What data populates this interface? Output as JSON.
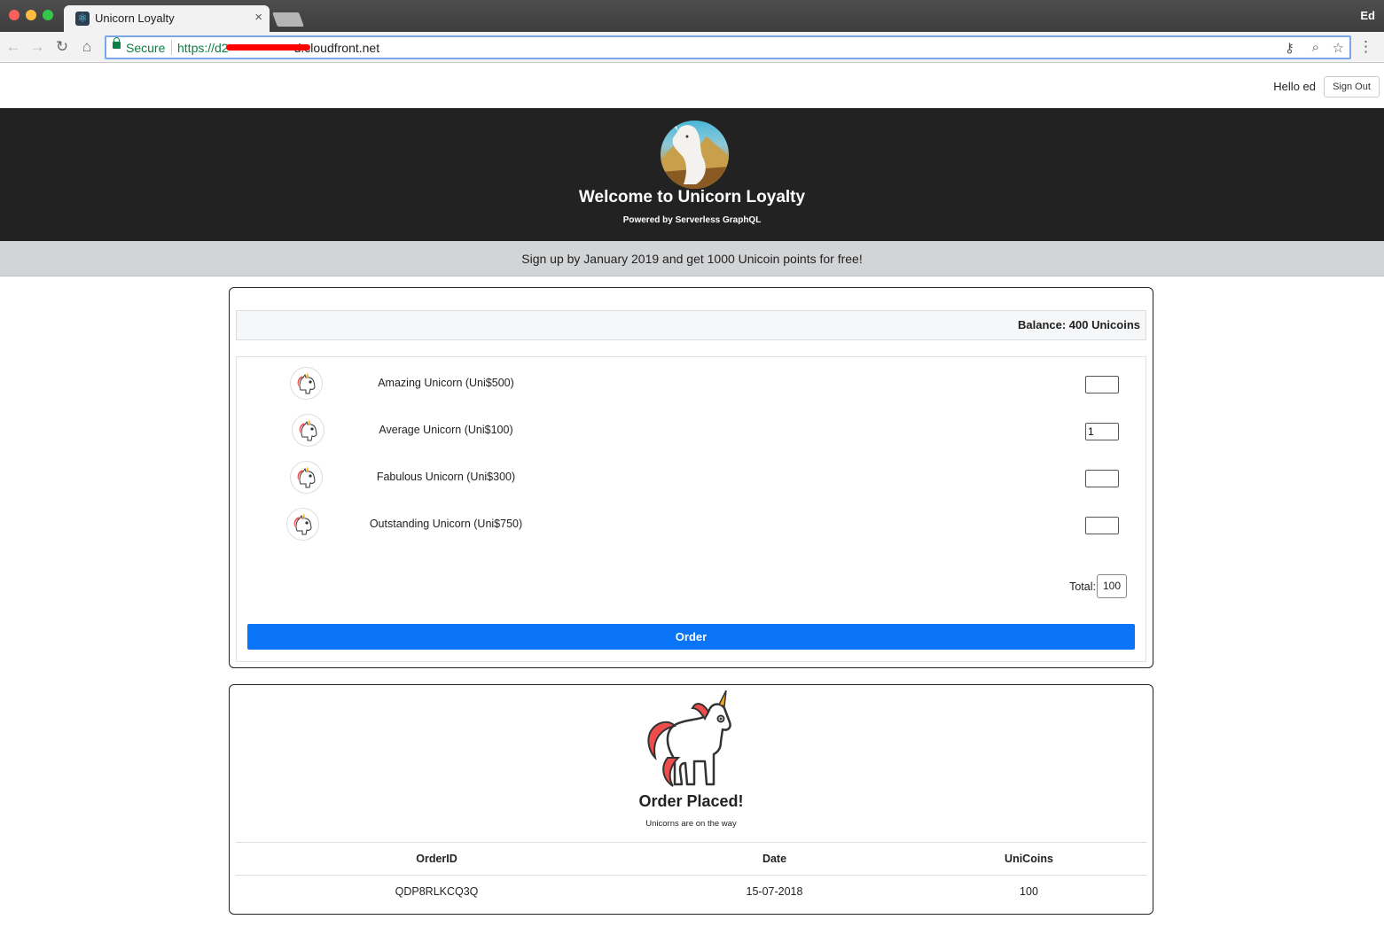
{
  "browser": {
    "tab_title": "Unicorn Loyalty",
    "tab_close": "×",
    "profile": "Ed",
    "secure_label": "Secure",
    "url_prefix": "https://d2",
    "url_host": "d.cloudfront.net"
  },
  "header": {
    "greeting": "Hello ed",
    "sign_out_label": "Sign Out",
    "title": "Welcome to Unicorn Loyalty",
    "subtitle": "Powered by Serverless GraphQL"
  },
  "promo": "Sign up by January 2019 and get 1000 Unicoin points for free!",
  "order_form": {
    "balance": "Balance: 400 Unicoins",
    "products": [
      {
        "label": "Amazing Unicorn (Uni$500)",
        "qty": ""
      },
      {
        "label": "Average Unicorn (Uni$100)",
        "qty": "1"
      },
      {
        "label": "Fabulous Unicorn (Uni$300)",
        "qty": ""
      },
      {
        "label": "Outstanding Unicorn (Uni$750)",
        "qty": ""
      }
    ],
    "total_label": "Total:",
    "total_value": "100",
    "order_button": "Order"
  },
  "confirmation": {
    "title": "Order Placed!",
    "subtitle": "Unicorns are on the way",
    "columns": [
      "OrderID",
      "Date",
      "UniCoins"
    ],
    "rows": [
      [
        "QDP8RLKCQ3Q",
        "15-07-2018",
        "100"
      ]
    ]
  },
  "colors": {
    "hero_bg": "#222222",
    "promo_bg": "#d3d4d6",
    "primary_button": "#0a74f7",
    "secure_green": "#0b8043"
  },
  "icons": {
    "back": "arrow-left-icon",
    "forward": "arrow-right-icon",
    "reload": "reload-icon",
    "home": "home-icon",
    "lock": "lock-icon",
    "key": "key-icon",
    "zoom": "zoom-icon",
    "star": "star-icon",
    "menu": "kebab-menu-icon",
    "product": "unicorn-icon"
  }
}
